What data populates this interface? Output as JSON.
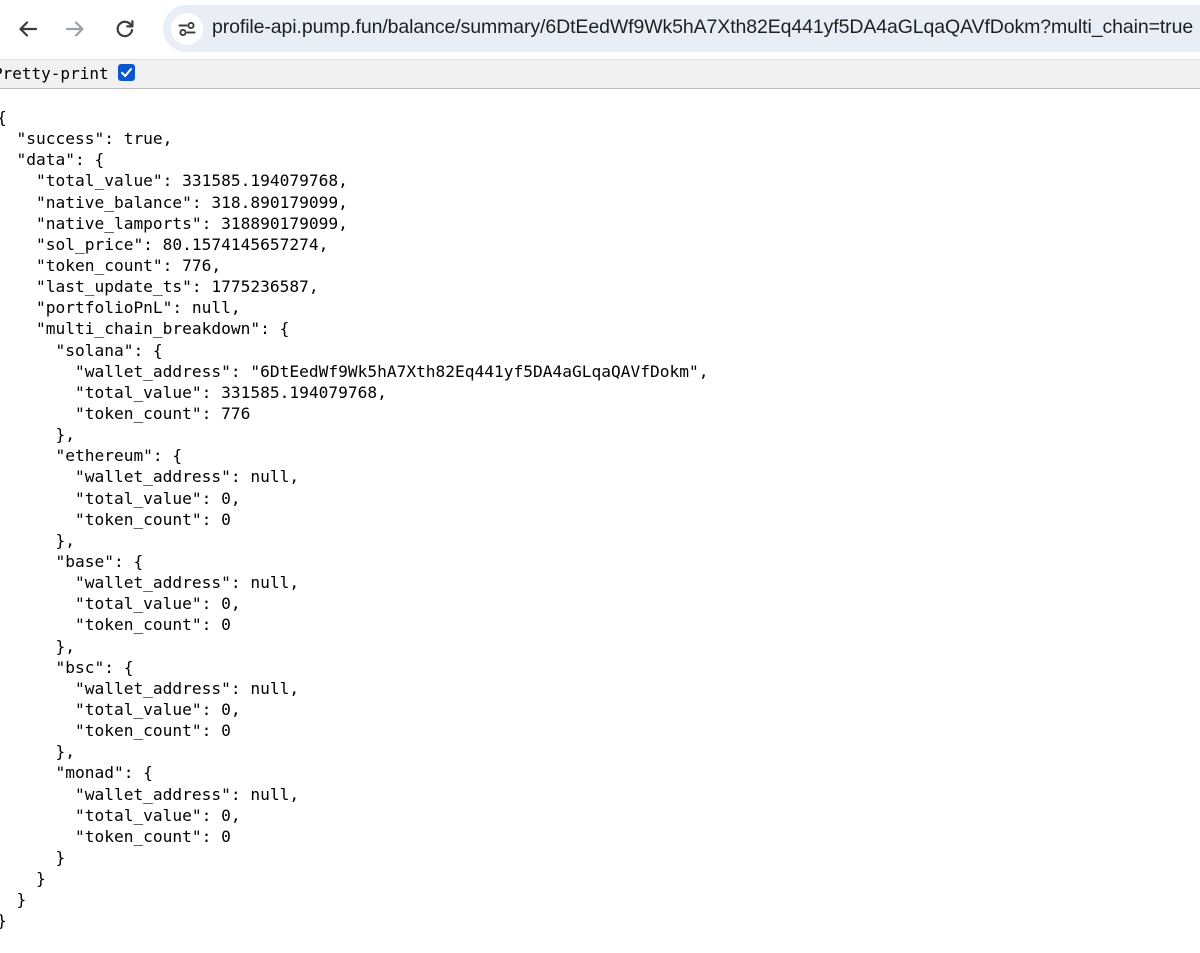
{
  "browser": {
    "url": "profile-api.pump.fun/balance/summary/6DtEedWf9Wk5hA7Xth82Eq441yf5DA4aGLqaQAVfDokm?multi_chain=true",
    "icons": [
      "back-arrow-icon",
      "forward-arrow-icon",
      "reload-icon",
      "site-info-icon"
    ]
  },
  "pretty_print": {
    "label": "Pretty-print",
    "checked": true
  },
  "json_lines": [
    "{",
    "  \"success\": true,",
    "  \"data\": {",
    "    \"total_value\": 331585.194079768,",
    "    \"native_balance\": 318.890179099,",
    "    \"native_lamports\": 318890179099,",
    "    \"sol_price\": 80.1574145657274,",
    "    \"token_count\": 776,",
    "    \"last_update_ts\": 1775236587,",
    "    \"portfolioPnL\": null,",
    "    \"multi_chain_breakdown\": {",
    "      \"solana\": {",
    "        \"wallet_address\": \"6DtEedWf9Wk5hA7Xth82Eq441yf5DA4aGLqaQAVfDokm\",",
    "        \"total_value\": 331585.194079768,",
    "        \"token_count\": 776",
    "      },",
    "      \"ethereum\": {",
    "        \"wallet_address\": null,",
    "        \"total_value\": 0,",
    "        \"token_count\": 0",
    "      },",
    "      \"base\": {",
    "        \"wallet_address\": null,",
    "        \"total_value\": 0,",
    "        \"token_count\": 0",
    "      },",
    "      \"bsc\": {",
    "        \"wallet_address\": null,",
    "        \"total_value\": 0,",
    "        \"token_count\": 0",
    "      },",
    "      \"monad\": {",
    "        \"wallet_address\": null,",
    "        \"total_value\": 0,",
    "        \"token_count\": 0",
    "      }",
    "    }",
    "  }",
    "}"
  ]
}
